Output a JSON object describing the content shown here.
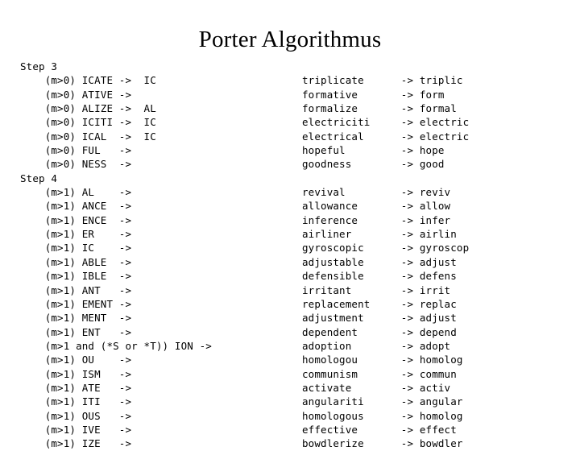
{
  "slide": {
    "title": "Porter Algorithmus"
  },
  "sections": [
    {
      "label": "Step 3",
      "rows": [
        {
          "rule": "    (m>0) ICATE ->  IC",
          "example": "triplicate      -> triplic"
        },
        {
          "rule": "    (m>0) ATIVE ->",
          "example": "formative       -> form"
        },
        {
          "rule": "    (m>0) ALIZE ->  AL",
          "example": "formalize       -> formal"
        },
        {
          "rule": "    (m>0) ICITI ->  IC",
          "example": "electriciti     -> electric"
        },
        {
          "rule": "    (m>0) ICAL  ->  IC",
          "example": "electrical      -> electric"
        },
        {
          "rule": "    (m>0) FUL   ->",
          "example": "hopeful         -> hope"
        },
        {
          "rule": "    (m>0) NESS  ->",
          "example": "goodness        -> good"
        }
      ]
    },
    {
      "label": "Step 4",
      "rows": [
        {
          "rule": "    (m>1) AL    ->",
          "example": "revival         -> reviv"
        },
        {
          "rule": "    (m>1) ANCE  ->",
          "example": "allowance       -> allow"
        },
        {
          "rule": "    (m>1) ENCE  ->",
          "example": "inference       -> infer"
        },
        {
          "rule": "    (m>1) ER    ->",
          "example": "airliner        -> airlin"
        },
        {
          "rule": "    (m>1) IC    ->",
          "example": "gyroscopic      -> gyroscop"
        },
        {
          "rule": "    (m>1) ABLE  ->",
          "example": "adjustable      -> adjust"
        },
        {
          "rule": "    (m>1) IBLE  ->",
          "example": "defensible      -> defens"
        },
        {
          "rule": "    (m>1) ANT   ->",
          "example": "irritant        -> irrit"
        },
        {
          "rule": "    (m>1) EMENT ->",
          "example": "replacement     -> replac"
        },
        {
          "rule": "    (m>1) MENT  ->",
          "example": "adjustment      -> adjust"
        },
        {
          "rule": "    (m>1) ENT   ->",
          "example": "dependent       -> depend"
        },
        {
          "rule": "    (m>1 and (*S or *T)) ION ->",
          "example": "adoption        -> adopt"
        },
        {
          "rule": "    (m>1) OU    ->",
          "example": "homologou       -> homolog"
        },
        {
          "rule": "    (m>1) ISM   ->",
          "example": "communism       -> commun"
        },
        {
          "rule": "    (m>1) ATE   ->",
          "example": "activate        -> activ"
        },
        {
          "rule": "    (m>1) ITI   ->",
          "example": "angulariti      -> angular"
        },
        {
          "rule": "    (m>1) OUS   ->",
          "example": "homologous      -> homolog"
        },
        {
          "rule": "    (m>1) IVE   ->",
          "example": "effective       -> effect"
        },
        {
          "rule": "    (m>1) IZE   ->",
          "example": "bowdlerize      -> bowdler"
        }
      ]
    }
  ]
}
